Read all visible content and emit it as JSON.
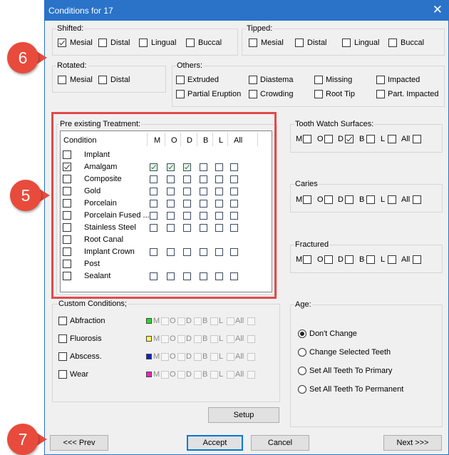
{
  "window": {
    "title": "Conditions for 17"
  },
  "shifted": {
    "label": "Shifted:",
    "items": [
      {
        "label": "Mesial",
        "checked": true
      },
      {
        "label": "Distal",
        "checked": false
      },
      {
        "label": "Lingual",
        "checked": false
      },
      {
        "label": "Buccal",
        "checked": false
      }
    ]
  },
  "tipped": {
    "label": "Tipped:",
    "items": [
      {
        "label": "Mesial",
        "checked": false
      },
      {
        "label": "Distal",
        "checked": false
      },
      {
        "label": "Lingual",
        "checked": false
      },
      {
        "label": "Buccal",
        "checked": false
      }
    ]
  },
  "rotated": {
    "label": "Rotated:",
    "items": [
      {
        "label": "Mesial",
        "checked": false
      },
      {
        "label": "Distal",
        "checked": false
      }
    ]
  },
  "others": {
    "label": "Others:",
    "items": [
      {
        "label": "Extruded"
      },
      {
        "label": "Diastema"
      },
      {
        "label": "Missing"
      },
      {
        "label": "Impacted"
      },
      {
        "label": "Partial Eruption"
      },
      {
        "label": "Crowding"
      },
      {
        "label": "Root Tip"
      },
      {
        "label": "Part. Impacted"
      }
    ]
  },
  "pre": {
    "label": "Pre existing Treatment:",
    "headers": [
      "Condition",
      "M",
      "O",
      "D",
      "B",
      "L",
      "All"
    ],
    "rows": [
      {
        "name": "Implant",
        "checked": false,
        "has_surfaces": false,
        "surfaces": []
      },
      {
        "name": "Amalgam",
        "checked": true,
        "has_surfaces": true,
        "surfaces": [
          true,
          true,
          true,
          false,
          false,
          false
        ]
      },
      {
        "name": "Composite",
        "checked": false,
        "has_surfaces": true,
        "surfaces": [
          false,
          false,
          false,
          false,
          false,
          false
        ]
      },
      {
        "name": "Gold",
        "checked": false,
        "has_surfaces": true,
        "surfaces": [
          false,
          false,
          false,
          false,
          false,
          false
        ]
      },
      {
        "name": "Porcelain",
        "checked": false,
        "has_surfaces": true,
        "surfaces": [
          false,
          false,
          false,
          false,
          false,
          false
        ]
      },
      {
        "name": "Porcelain Fused ...",
        "checked": false,
        "has_surfaces": true,
        "surfaces": [
          false,
          false,
          false,
          false,
          false,
          false
        ]
      },
      {
        "name": "Stainless Steel",
        "checked": false,
        "has_surfaces": true,
        "surfaces": [
          false,
          false,
          false,
          false,
          false,
          false
        ]
      },
      {
        "name": "Root Canal",
        "checked": false,
        "has_surfaces": false,
        "surfaces": []
      },
      {
        "name": "Implant Crown",
        "checked": false,
        "has_surfaces": true,
        "surfaces": [
          false,
          false,
          false,
          false,
          false,
          false
        ]
      },
      {
        "name": "Post",
        "checked": false,
        "has_surfaces": false,
        "surfaces": []
      },
      {
        "name": "Sealant",
        "checked": false,
        "has_surfaces": true,
        "surfaces": [
          false,
          false,
          false,
          false,
          false,
          false
        ]
      }
    ]
  },
  "custom": {
    "label": "Custom Conditions;",
    "surface_labels": [
      "M",
      "O",
      "D",
      "B",
      "L",
      "All"
    ],
    "rows": [
      {
        "name": "Abfraction",
        "color": "#22dd22"
      },
      {
        "name": "Fluorosis",
        "color": "#ffff55"
      },
      {
        "name": "Abscess.",
        "color": "#1122cc"
      },
      {
        "name": "Wear",
        "color": "#ee22bb"
      }
    ]
  },
  "setup_button": "Setup",
  "tooth_watch": {
    "label": "Tooth Watch Surfaces:",
    "surfaces": [
      {
        "label": "M",
        "checked": false
      },
      {
        "label": "O",
        "checked": false
      },
      {
        "label": "D",
        "checked": true
      },
      {
        "label": "B",
        "checked": false
      },
      {
        "label": "L",
        "checked": false
      },
      {
        "label": "All",
        "checked": false
      }
    ]
  },
  "caries": {
    "label": "Caries",
    "surfaces": [
      {
        "label": "M"
      },
      {
        "label": "O"
      },
      {
        "label": "D"
      },
      {
        "label": "B"
      },
      {
        "label": "L"
      },
      {
        "label": "All"
      }
    ]
  },
  "fractured": {
    "label": "Fractured",
    "surfaces": [
      {
        "label": "M"
      },
      {
        "label": "O"
      },
      {
        "label": "D"
      },
      {
        "label": "B"
      },
      {
        "label": "L"
      },
      {
        "label": "All"
      }
    ]
  },
  "age": {
    "label": "Age:",
    "options": [
      {
        "label": "Don't Change",
        "selected": true
      },
      {
        "label": "Change Selected Teeth",
        "selected": false
      },
      {
        "label": "Set All Teeth To Primary",
        "selected": false
      },
      {
        "label": "Set All Teeth To Permanent",
        "selected": false
      }
    ]
  },
  "buttons": {
    "prev": "<<< Prev",
    "accept": "Accept",
    "cancel": "Cancel",
    "next": "Next >>>"
  },
  "callouts": {
    "c5": "5",
    "c6": "6",
    "c7": "7"
  },
  "colors": {
    "titlebar": "#2a73c9",
    "callout": "#e84b3c",
    "highlight": "#e34a4a"
  }
}
